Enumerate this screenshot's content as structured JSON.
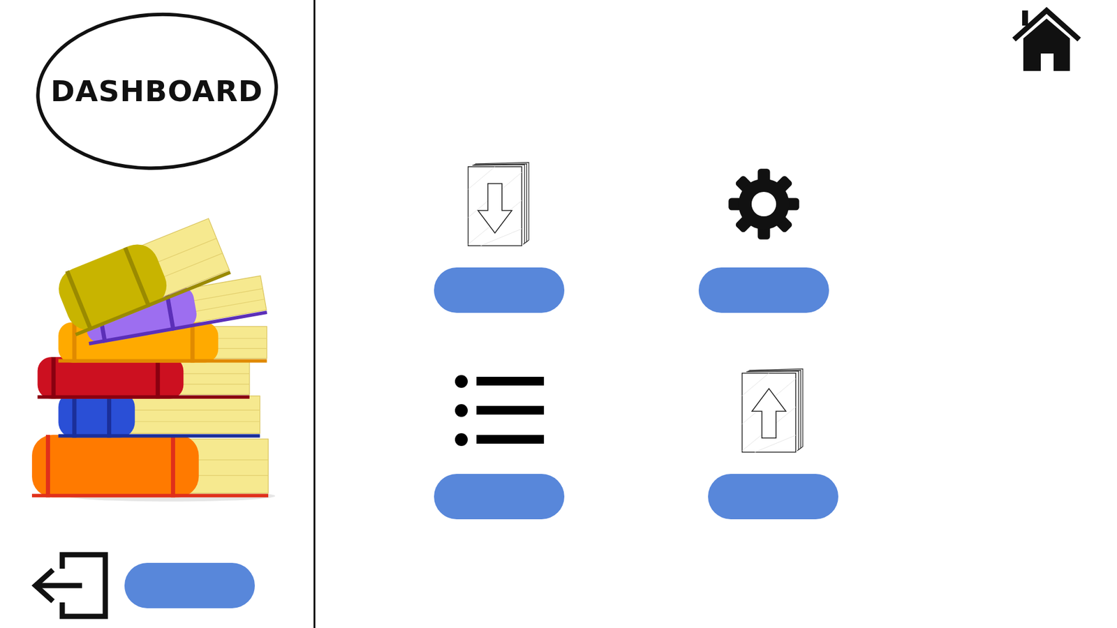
{
  "sidebar": {
    "title": "DASHBOARD"
  },
  "actions": [
    {
      "kind": "download"
    },
    {
      "kind": "settings"
    },
    {
      "kind": "list"
    },
    {
      "kind": "upload"
    }
  ]
}
